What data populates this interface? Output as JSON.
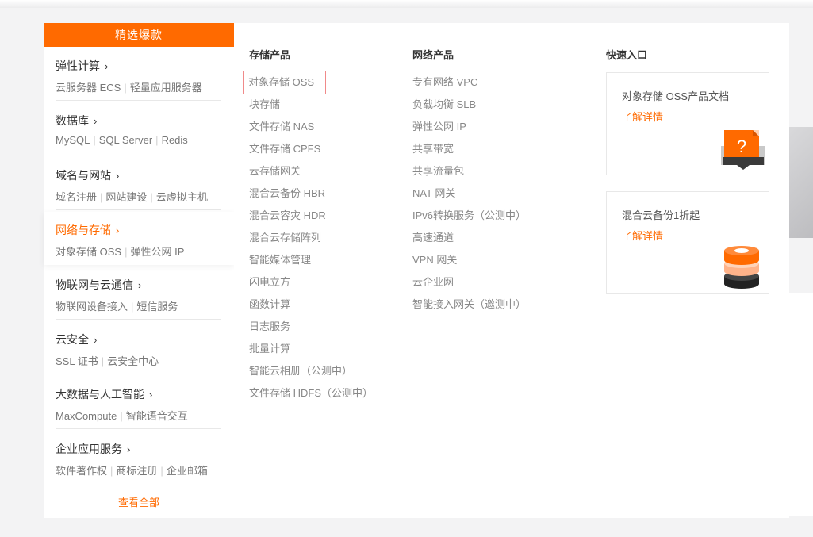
{
  "hot_header": "精选爆款",
  "categories": [
    {
      "title": "弹性计算",
      "subs": [
        "云服务器 ECS",
        "轻量应用服务器"
      ]
    },
    {
      "title": "数据库",
      "subs": [
        "MySQL",
        "SQL Server",
        "Redis"
      ]
    },
    {
      "title": "域名与网站",
      "subs": [
        "域名注册",
        "网站建设",
        "云虚拟主机"
      ]
    },
    {
      "title": "网络与存储",
      "subs": [
        "对象存储 OSS",
        "弹性公网 IP"
      ]
    },
    {
      "title": "物联网与云通信",
      "subs": [
        "物联网设备接入",
        "短信服务"
      ]
    },
    {
      "title": "云安全",
      "subs": [
        "SSL 证书",
        "云安全中心"
      ]
    },
    {
      "title": "大数据与人工智能",
      "subs": [
        "MaxCompute",
        "智能语音交互"
      ]
    },
    {
      "title": "企业应用服务",
      "subs": [
        "软件著作权",
        "商标注册",
        "企业邮箱"
      ]
    }
  ],
  "view_all": "查看全部",
  "storage": {
    "title": "存储产品",
    "items": [
      "对象存储 OSS",
      "块存储",
      "文件存储 NAS",
      "文件存储 CPFS",
      "云存储网关",
      "混合云备份 HBR",
      "混合云容灾 HDR",
      "混合云存储阵列",
      "智能媒体管理",
      "闪电立方",
      "函数计算",
      "日志服务",
      "批量计算",
      "智能云相册（公测中）",
      "文件存储 HDFS（公测中）"
    ]
  },
  "network": {
    "title": "网络产品",
    "items": [
      "专有网络 VPC",
      "负载均衡 SLB",
      "弹性公网 IP",
      "共享带宽",
      "共享流量包",
      "NAT 网关",
      "IPv6转换服务（公测中）",
      "高速通道",
      "VPN 网关",
      "云企业网",
      "智能接入网关（邀测中）"
    ]
  },
  "quick": {
    "title": "快速入口",
    "cards": [
      {
        "title": "对象存储 OSS产品文档",
        "link": "了解详情",
        "icon": "document-question-icon"
      },
      {
        "title": "混合云备份1折起",
        "link": "了解详情",
        "icon": "storage-stack-icon"
      }
    ]
  },
  "colors": {
    "accent": "#ff6a00",
    "highlight_border": "#f08a8a"
  }
}
